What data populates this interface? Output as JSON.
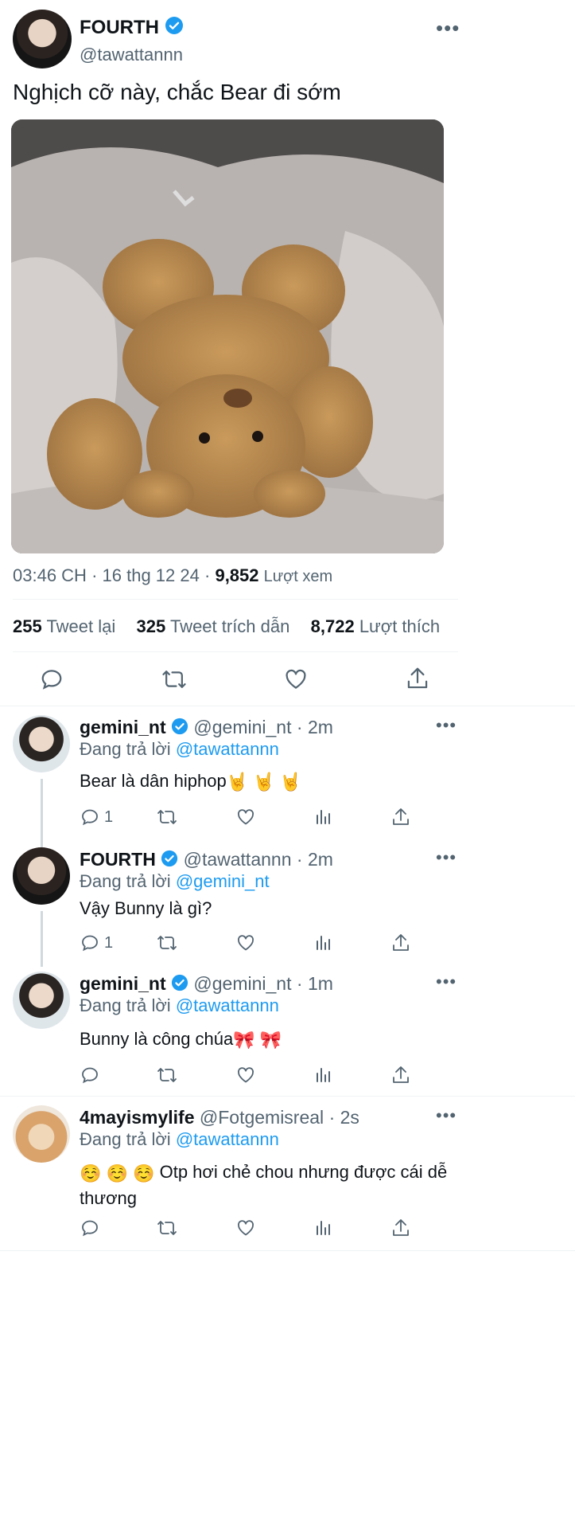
{
  "main_tweet": {
    "author_name": "FOURTH",
    "handle": "@tawattannn",
    "text": "Nghịch cỡ này, chắc Bear đi sớm",
    "time": "03:46 CH",
    "date": "16 thg 12 24",
    "views": "9,852",
    "views_label": "Lượt xem",
    "retweets": "255",
    "retweets_label": "Tweet lại",
    "quotes": "325",
    "quotes_label": "Tweet trích dẫn",
    "likes": "8,722",
    "likes_label": "Lượt thích",
    "separator": "·"
  },
  "replies": [
    {
      "author_name": "gemini_nt",
      "handle": "@gemini_nt",
      "time": "2m",
      "replying_label": "Đang trả lời",
      "replying_to": "@tawattannn",
      "text": "Bear là dân hiphop",
      "reply_count": "1"
    },
    {
      "author_name": "FOURTH",
      "handle": "@tawattannn",
      "time": "2m",
      "replying_label": "Đang trả lời",
      "replying_to": "@gemini_nt",
      "text": "Vậy Bunny là gì?",
      "reply_count": "1"
    },
    {
      "author_name": "gemini_nt",
      "handle": "@gemini_nt",
      "time": "1m",
      "replying_label": "Đang trả lời",
      "replying_to": "@tawattannn",
      "text": "Bunny là công chúa",
      "reply_count": ""
    },
    {
      "author_name": "4mayismylife",
      "handle": "@Fotgemisreal",
      "time": "2s",
      "replying_label": "Đang trả lời",
      "replying_to": "@tawattannn",
      "text": "Otp hơi chẻ chou nhưng được cái dễ thương",
      "reply_count": ""
    }
  ],
  "colors": {
    "accent": "#1d9bf0",
    "text": "#0f1419",
    "secondary": "#536471",
    "divider": "#eff3f4"
  },
  "icons": [
    "verified-badge-icon",
    "more-icon",
    "reply-icon",
    "retweet-icon",
    "like-icon",
    "share-icon",
    "views-icon",
    "rock-hand-emoji",
    "ribbon-emoji",
    "smiling-emoji"
  ]
}
